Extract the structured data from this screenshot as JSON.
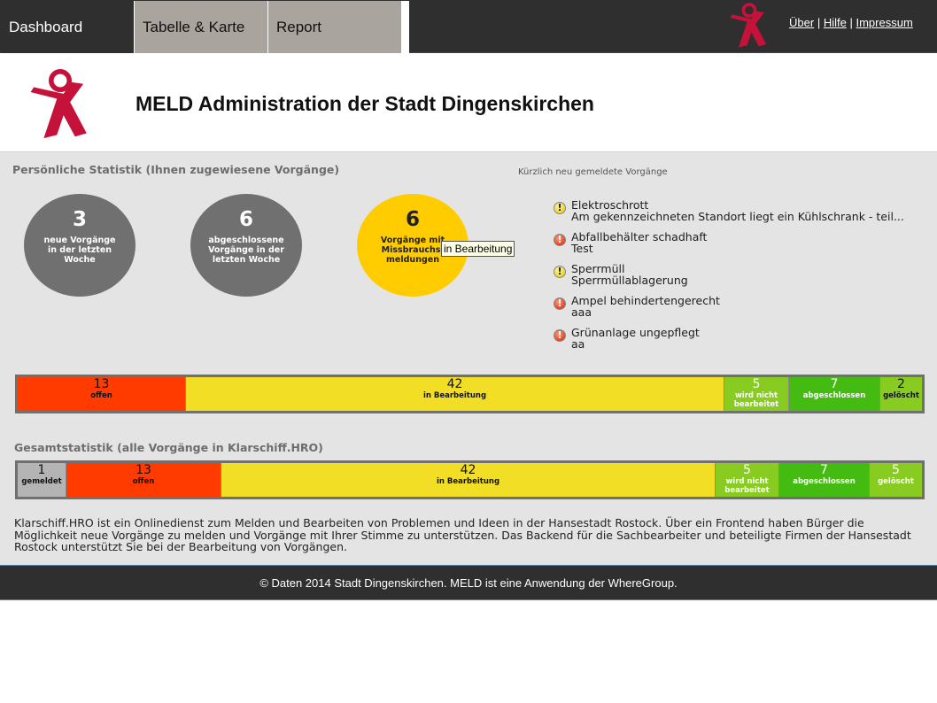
{
  "nav": {
    "tabs": [
      {
        "label": "Dashboard"
      },
      {
        "label": "Tabelle & Karte"
      },
      {
        "label": "Report"
      }
    ],
    "links": [
      {
        "label": "Über"
      },
      {
        "label": "Hilfe"
      },
      {
        "label": "Impressum"
      }
    ],
    "separator": "|"
  },
  "header": {
    "title": "MELD Administration der Stadt Dingenskirchen"
  },
  "personal": {
    "title": "Persönliche Statistik (Ihnen zugewiesene Vorgänge)",
    "circles": [
      {
        "value": "3",
        "label": "neue Vorgänge in der letzten Woche",
        "color": "#707070"
      },
      {
        "value": "6",
        "label": "abgeschlossene Vorgänge in der letzten Woche",
        "color": "#707070"
      },
      {
        "value": "6",
        "label": "Vorgänge mit Missbrauchs-meldungen",
        "color": "#ffcc00"
      }
    ]
  },
  "recent": {
    "title": "Kürzlich neu gemeldete Vorgänge",
    "items": [
      {
        "icon": "warning-icon",
        "title": "Elektroschrott",
        "detail": "Am gekennzeichneten Standort liegt ein Kühlschrank - teil..."
      },
      {
        "icon": "error-icon",
        "title": "Abfallbehälter schadhaft",
        "detail": "Test"
      },
      {
        "icon": "warning-icon",
        "title": "Sperrmüll",
        "detail": "Sperrmüllablagerung"
      },
      {
        "icon": "error-icon",
        "title": "Ampel behindertengerecht",
        "detail": "aaa"
      },
      {
        "icon": "error-icon",
        "title": "Grünanlage ungepflegt",
        "detail": "aa"
      }
    ]
  },
  "personal_bar": [
    {
      "value": "13",
      "label": "offen",
      "color": "#ff3b00"
    },
    {
      "value": "42",
      "label": "in Bearbeitung",
      "color": "#f2de24"
    },
    {
      "value": "5",
      "label": "wird nicht bearbeitet",
      "color": "#88cc22"
    },
    {
      "value": "7",
      "label": "abgeschlossen",
      "color": "#44bb11"
    },
    {
      "value": "2",
      "label": "gelöscht",
      "color": "#88cc22"
    }
  ],
  "tooltip": "in Bearbeitung",
  "total": {
    "title": "Gesamtstatistik (alle Vorgänge in Klarschiff.HRO)",
    "bar": [
      {
        "value": "1",
        "label": "gemeldet",
        "color": "#b4b4b4"
      },
      {
        "value": "13",
        "label": "offen",
        "color": "#ff3b00"
      },
      {
        "value": "42",
        "label": "in Bearbeitung",
        "color": "#f2de24"
      },
      {
        "value": "5",
        "label": "wird nicht bearbeitet",
        "color": "#88cc22"
      },
      {
        "value": "7",
        "label": "abgeschlossen",
        "color": "#44bb11"
      },
      {
        "value": "5",
        "label": "gelöscht",
        "color": "#88cc22"
      }
    ]
  },
  "description": "Klarschiff.HRO ist ein Onlinedienst zum Melden und Bearbeiten von Problemen und Ideen in der Hansestadt Rostock. Über ein Frontend haben Bürger die Möglichkeit neue Vorgänge zu melden und Vorgänge mit Ihrer Stimme zu unterstützen. Das Backend für die Sachbearbeiter und beteiligte Firmen der Hansestadt Rostock unterstützt Sie bei der Bearbeitung von Vorgängen.",
  "footer": {
    "text": "© Daten 2014 Stadt Dingenskirchen. MELD ist eine Anwendung der WhereGroup."
  }
}
